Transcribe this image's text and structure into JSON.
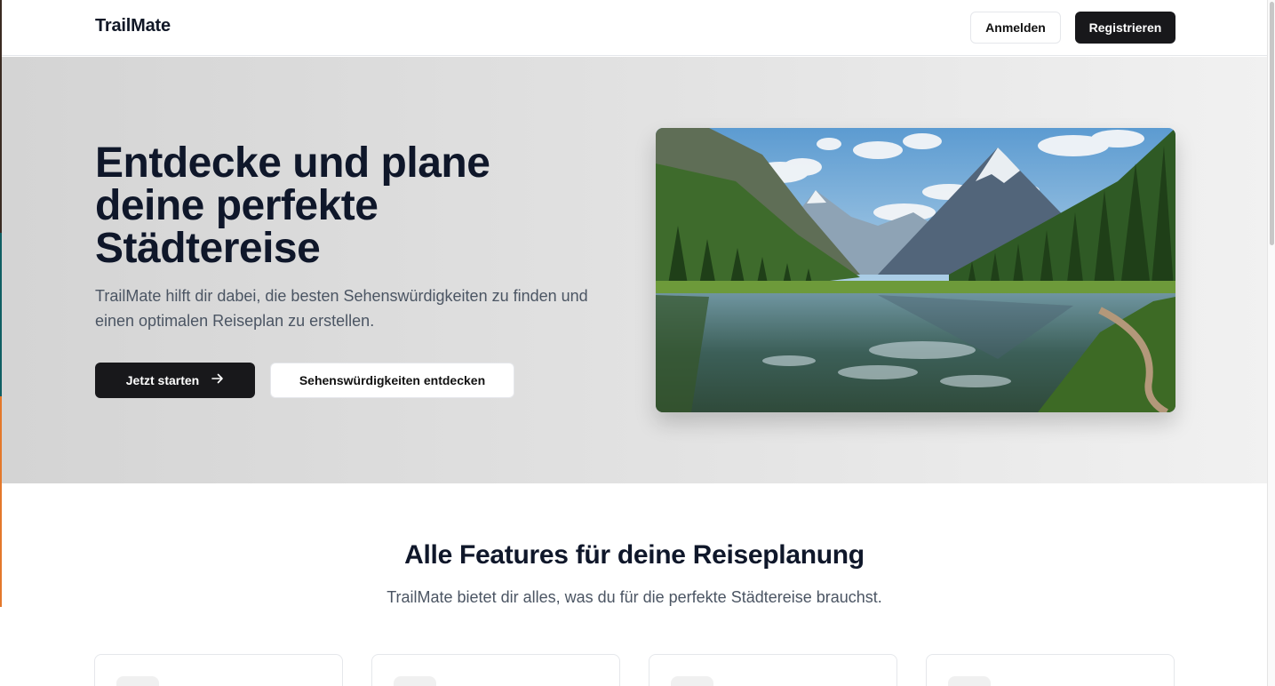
{
  "navbar": {
    "logo": "TrailMate",
    "login_label": "Anmelden",
    "register_label": "Registrieren"
  },
  "hero": {
    "title": "Entdecke und plane deine perfekte Städtereise",
    "subtitle": "TrailMate hilft dir dabei, die besten Sehenswürdigkeiten zu finden und einen optimalen Reiseplan zu erstellen.",
    "primary_button": "Jetzt starten",
    "primary_button_icon": "arrow-right-icon",
    "secondary_button": "Sehenswürdigkeiten entdecken",
    "image_alt": "mountain-lake-landscape"
  },
  "features": {
    "title": "Alle Features für deine Reiseplanung",
    "subtitle": "TrailMate bietet dir alles, was du für die perfekte Städtereise brauchst.",
    "cards": [
      {
        "icon": "feature-icon-placeholder"
      },
      {
        "icon": "feature-icon-placeholder"
      },
      {
        "icon": "feature-icon-placeholder"
      },
      {
        "icon": "feature-icon-placeholder"
      }
    ]
  },
  "colors": {
    "primary_button": "#18181b",
    "heading": "#0f172a",
    "body_text": "#4b5563"
  }
}
